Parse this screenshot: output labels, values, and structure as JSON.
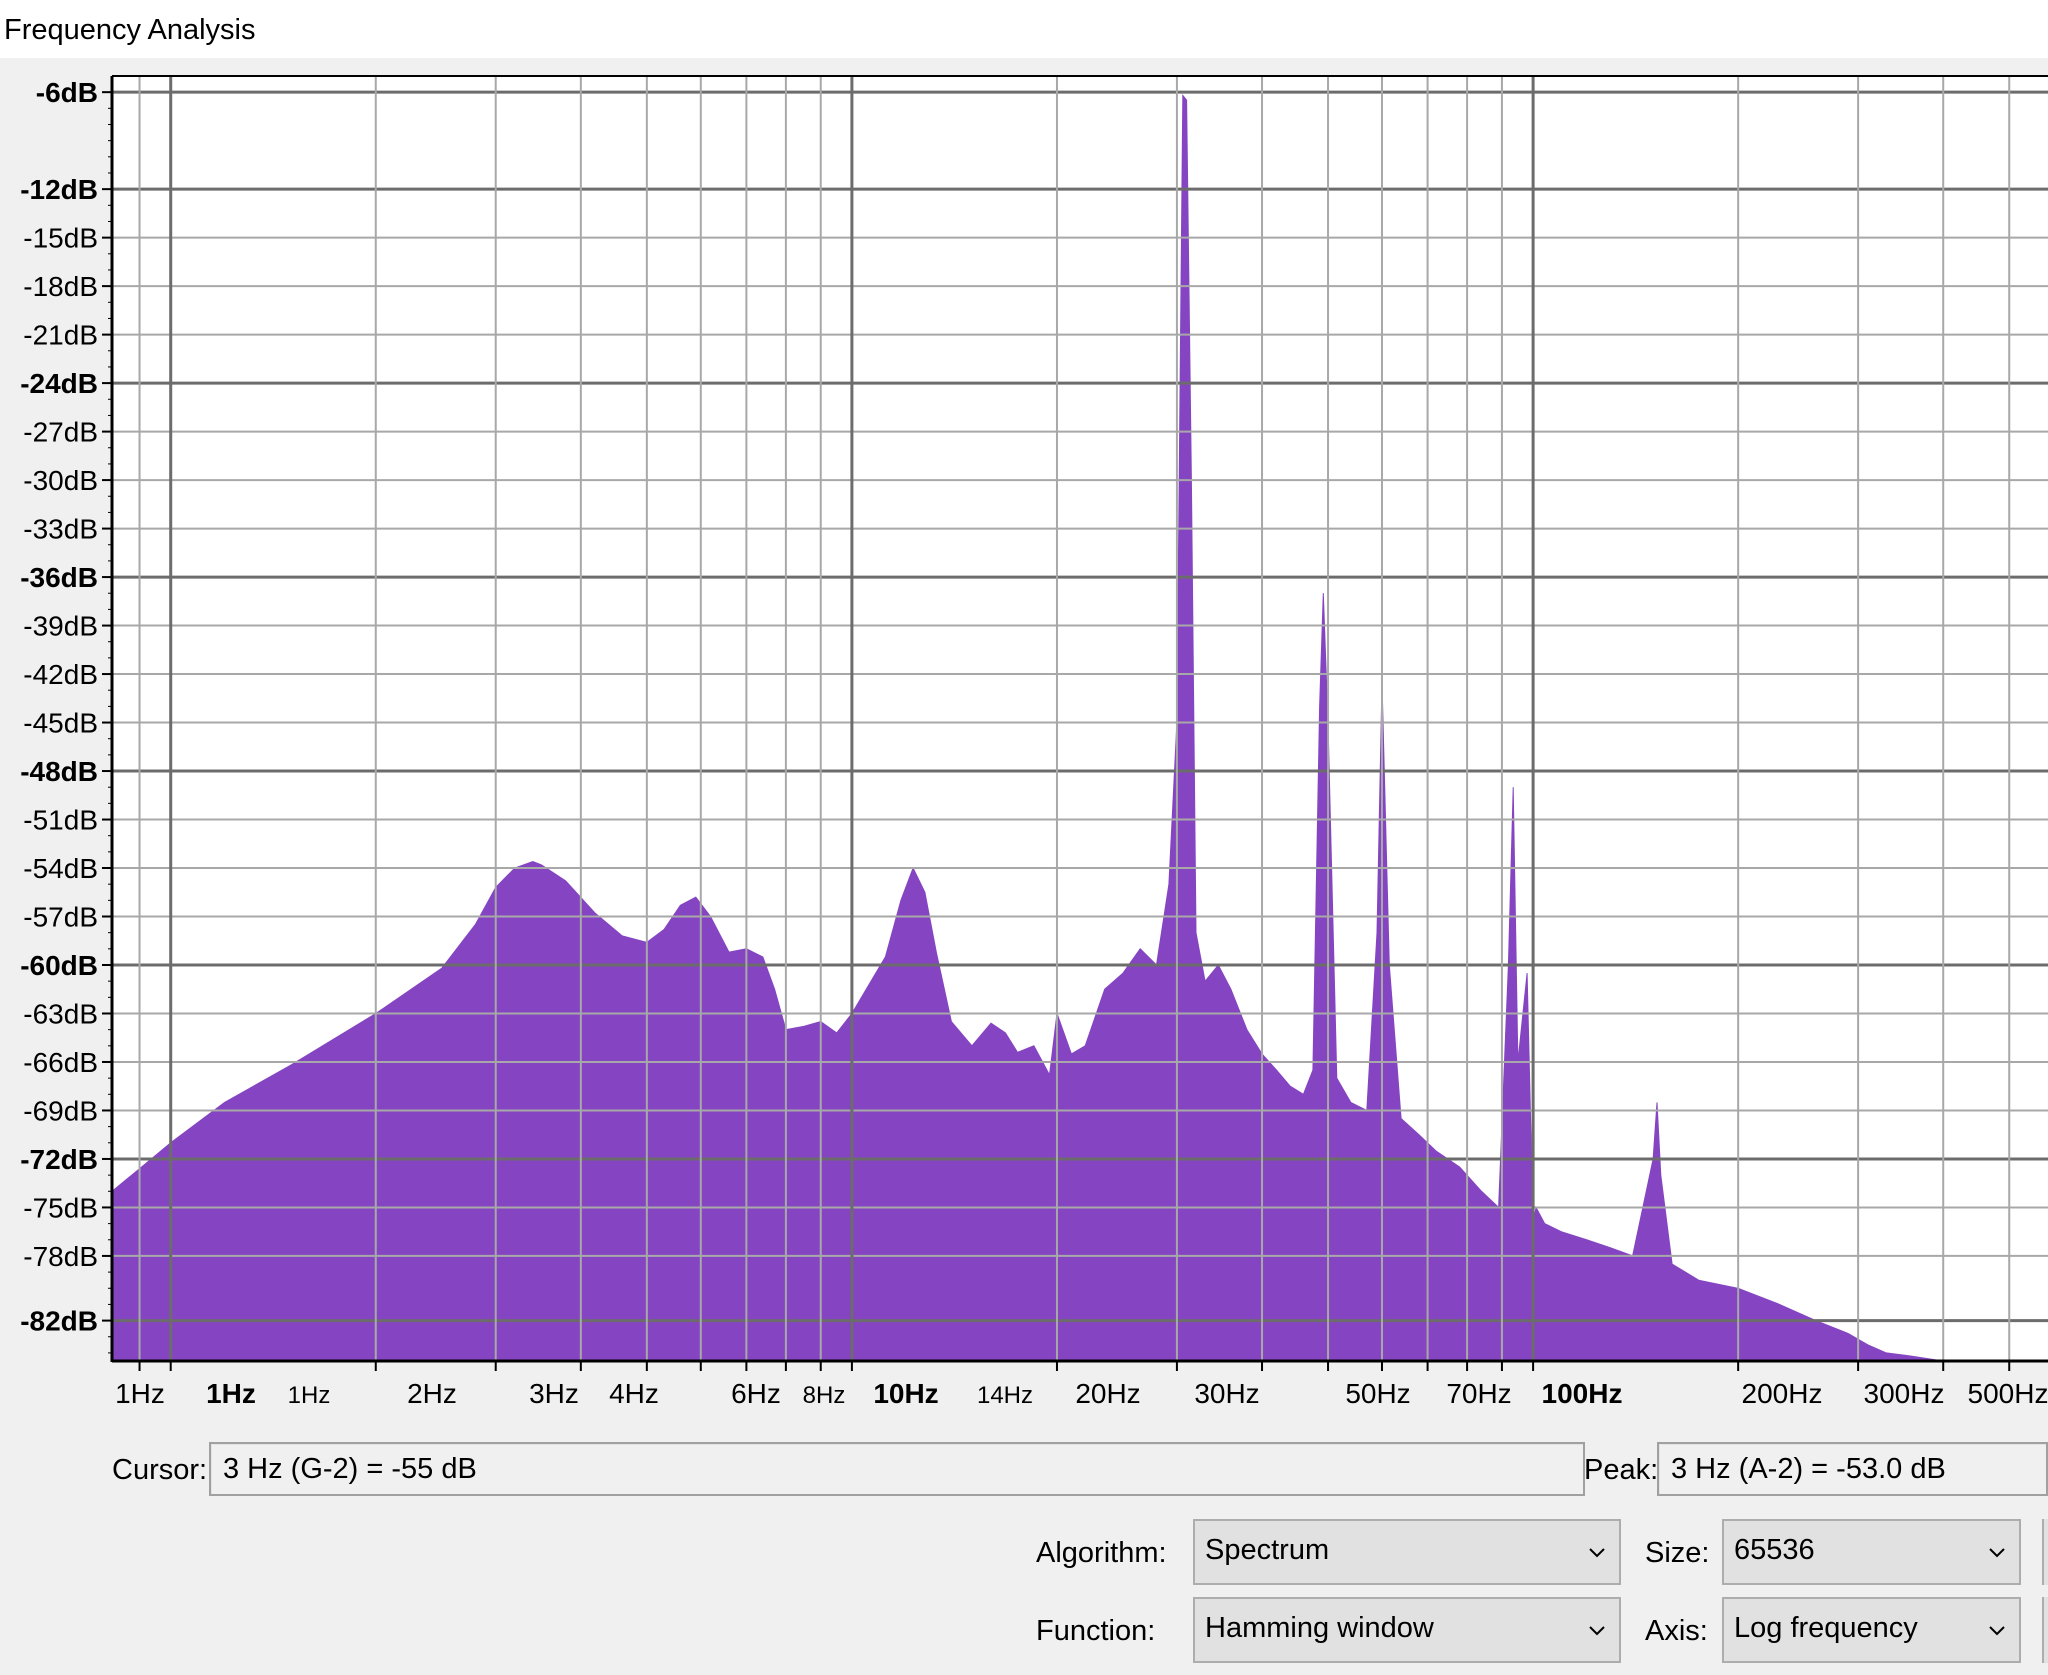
{
  "window": {
    "title": "Frequency Analysis"
  },
  "chart_data": {
    "type": "area",
    "title": "",
    "xlabel": "",
    "ylabel": "",
    "x_scale": "log",
    "xlim": [
      0.82,
      570
    ],
    "ylim": [
      -84.5,
      -5
    ],
    "grid": true,
    "fill_color": "#8545c2",
    "y_ticks": [
      "-6dB",
      "-12dB",
      "-15dB",
      "-18dB",
      "-21dB",
      "-24dB",
      "-27dB",
      "-30dB",
      "-33dB",
      "-36dB",
      "-39dB",
      "-42dB",
      "-45dB",
      "-48dB",
      "-51dB",
      "-54dB",
      "-57dB",
      "-60dB",
      "-63dB",
      "-66dB",
      "-69dB",
      "-72dB",
      "-75dB",
      "-78dB",
      "-82dB"
    ],
    "y_ticks_bold": [
      "-6dB",
      "-12dB",
      "-24dB",
      "-36dB",
      "-48dB",
      "-60dB",
      "-72dB",
      "-82dB"
    ],
    "x_ticks": [
      "1Hz",
      "1Hz",
      "1Hz",
      "2Hz",
      "3Hz",
      "4Hz",
      "6Hz",
      "8Hz",
      "10Hz",
      "14Hz",
      "20Hz",
      "30Hz",
      "50Hz",
      "70Hz",
      "100Hz",
      "200Hz",
      "300Hz",
      "500Hz"
    ],
    "x_ticks_bold": [
      "10Hz",
      "100Hz"
    ],
    "x": [
      0.82,
      0.9,
      1.0,
      1.2,
      1.5,
      2.0,
      2.5,
      2.8,
      3.0,
      3.2,
      3.4,
      3.5,
      3.8,
      4.2,
      4.6,
      5.0,
      5.3,
      5.6,
      5.9,
      6.2,
      6.6,
      7.0,
      7.4,
      7.7,
      8.0,
      8.5,
      9.0,
      9.5,
      10.0,
      10.6,
      11.2,
      11.8,
      12.3,
      12.8,
      13.3,
      14.0,
      15.0,
      16.0,
      16.8,
      17.5,
      18.5,
      19.5,
      20.0,
      21.0,
      22.0,
      23.5,
      25.0,
      26.5,
      28.0,
      29.2,
      30.0,
      30.6,
      31.0,
      31.5,
      32.0,
      33.0,
      34.5,
      36.0,
      38.0,
      40.0,
      42.0,
      44.0,
      46.0,
      47.5,
      48.6,
      49.2,
      50.0,
      51.5,
      54.0,
      57.0,
      59.0,
      60.0,
      61.5,
      64.0,
      68.0,
      72.0,
      78.0,
      84.0,
      89.0,
      92.0,
      93.5,
      95.0,
      98.0,
      100.0,
      101.0,
      104.0,
      110.0,
      120.0,
      130.0,
      140.0,
      150.0,
      152.0,
      154.0,
      160.0,
      175.0,
      200.0,
      230.0,
      260.0,
      290.0,
      310.0,
      330.0,
      360.0,
      400.0,
      460.0,
      520.0,
      570.0
    ],
    "y": [
      -74.0,
      -72.6,
      -71.0,
      -68.5,
      -66.2,
      -63.0,
      -60.2,
      -57.5,
      -55.2,
      -54.0,
      -53.6,
      -53.8,
      -54.8,
      -56.8,
      -58.2,
      -58.6,
      -57.8,
      -56.3,
      -55.8,
      -57.0,
      -59.2,
      -59.0,
      -59.5,
      -61.5,
      -64.0,
      -63.8,
      -63.5,
      -64.2,
      -63.0,
      -61.2,
      -59.5,
      -56.0,
      -54.0,
      -55.5,
      -59.2,
      -63.5,
      -65.0,
      -63.6,
      -64.2,
      -65.4,
      -65.0,
      -66.8,
      -63.0,
      -65.5,
      -65.0,
      -61.5,
      -60.5,
      -59.0,
      -60.0,
      -55.0,
      -45.0,
      -6.2,
      -6.5,
      -30.0,
      -58.0,
      -61.0,
      -60.0,
      -61.5,
      -64.0,
      -65.5,
      -66.5,
      -67.5,
      -68.0,
      -66.5,
      -44.0,
      -37.0,
      -45.0,
      -67.0,
      -68.5,
      -69.0,
      -58.0,
      -42.5,
      -60.0,
      -69.5,
      -70.5,
      -71.5,
      -72.5,
      -74.0,
      -75.0,
      -60.0,
      -49.0,
      -66.0,
      -60.5,
      -76.0,
      -75.0,
      -76.0,
      -76.5,
      -77.0,
      -77.5,
      -78.0,
      -72.0,
      -68.5,
      -73.0,
      -78.5,
      -79.5,
      -80.0,
      -81.0,
      -82.0,
      -82.8,
      -83.5,
      -84.0,
      -84.2,
      -84.5,
      -84.5,
      -84.5,
      -84.5
    ]
  },
  "cursor": {
    "label": "Cursor:",
    "value": "3 Hz (G-2) = -55 dB"
  },
  "peak": {
    "label": "Peak:",
    "value": "3 Hz (A-2) = -53.0 dB"
  },
  "controls": {
    "algorithm": {
      "label": "Algorithm:",
      "value": "Spectrum"
    },
    "size": {
      "label": "Size:",
      "value": "65536"
    },
    "function": {
      "label": "Function:",
      "value": "Hamming window"
    },
    "axis": {
      "label": "Axis:",
      "value": "Log frequency"
    }
  }
}
